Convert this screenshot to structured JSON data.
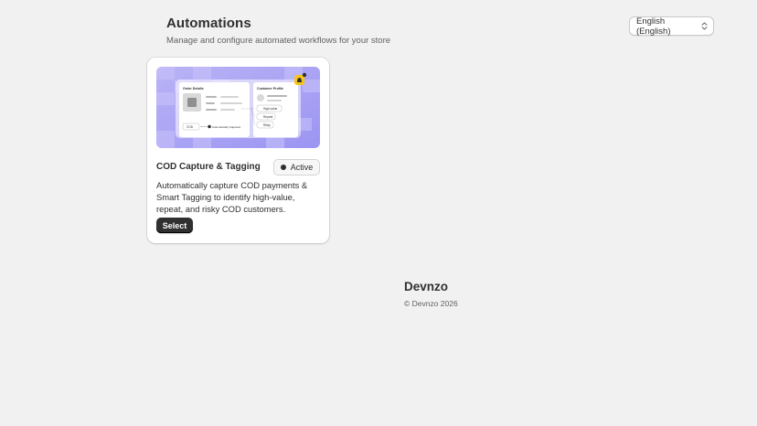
{
  "header": {
    "title": "Automations",
    "subtitle": "Manage and configure automated workflows for your store"
  },
  "language_select": {
    "value": "English (English)"
  },
  "card": {
    "title": "COD Capture & Tagging",
    "status": "Active",
    "description": "Automatically capture COD payments & Smart Tagging to identify high-value, repeat, and risky COD customers.",
    "select_label": "Select",
    "illustration": {
      "order_panel_title": "Order Details",
      "profile_panel_title": "Customer Profile",
      "cod_label": "COD",
      "captured_label": "Automatically Captured",
      "tags": [
        "High-value",
        "Repeat",
        "Risky"
      ]
    }
  },
  "footer": {
    "brand": "Devnzo",
    "copyright": "© Devnzo 2026"
  },
  "colors": {
    "background": "#f1f1f1",
    "primary_button": "#303030",
    "illustration_bg": "#a9a4f5"
  }
}
